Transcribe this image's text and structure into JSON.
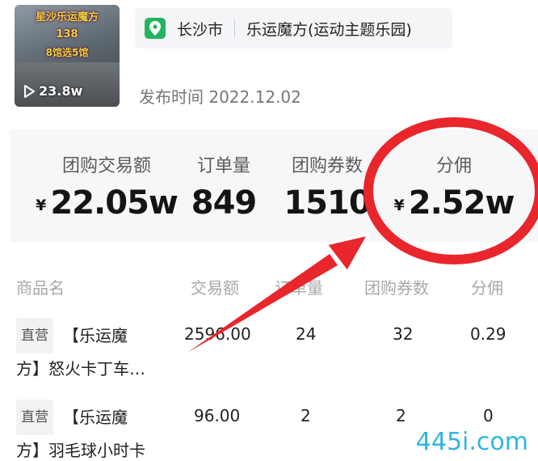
{
  "video": {
    "overlay_line1": "星沙乐运魔方",
    "overlay_line2": "138",
    "overlay_line3": "8馆选5馆",
    "views": "23.8w"
  },
  "location": {
    "city": "长沙市",
    "venue": "乐运魔方(运动主题乐园)"
  },
  "publish": {
    "label": "发布时间",
    "date": "2022.12.02"
  },
  "stats": [
    {
      "label": "团购交易额",
      "currency": "¥",
      "value": "22.05w"
    },
    {
      "label": "订单量",
      "currency": "",
      "value": "849"
    },
    {
      "label": "团购券数",
      "currency": "",
      "value": "1510"
    },
    {
      "label": "分佣",
      "currency": "¥",
      "value": "2.52w"
    }
  ],
  "table": {
    "headers": [
      "商品名",
      "交易额",
      "订单量",
      "团购券数",
      "分佣"
    ],
    "rows": [
      {
        "tag": "直营",
        "name_line1": "【乐运魔",
        "name_line2": "方】怒火卡丁车…",
        "amount": "2596.00",
        "orders": "24",
        "coupons": "32",
        "commission": "0.29"
      },
      {
        "tag": "直营",
        "name_line1": "【乐运魔",
        "name_line2": "方】羽毛球小时卡",
        "amount": "96.00",
        "orders": "2",
        "coupons": "2",
        "commission": "0"
      }
    ]
  },
  "watermark": "445i.com",
  "colors": {
    "highlight": "#e8262b",
    "pin": "#24b35f",
    "watermark": "#2fb6e0"
  }
}
